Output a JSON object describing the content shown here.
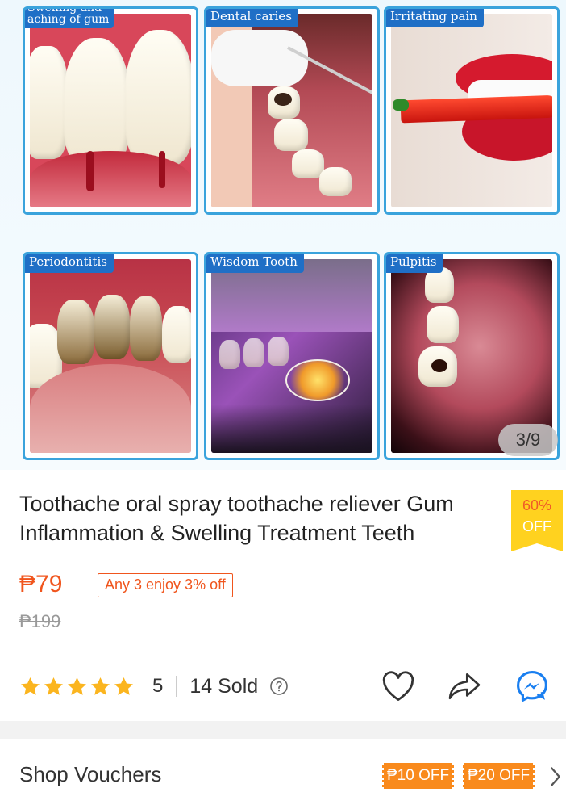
{
  "gallery": {
    "tiles": [
      {
        "label": "Swelling and\naching of gum"
      },
      {
        "label": "Dental caries"
      },
      {
        "label": "Irritating pain"
      },
      {
        "label": "Periodontitis"
      },
      {
        "label": "Wisdom Tooth"
      },
      {
        "label": "Pulpitis"
      }
    ],
    "counter": "3/9",
    "frame_color": "#3aa3dc",
    "tag_color": "#1f6fc6"
  },
  "product": {
    "title": "Toothache oral spray toothache reliever Gum Inflammation & Swelling Treatment Teeth",
    "discount_pct": "60%",
    "discount_off": "OFF",
    "price": "₱79",
    "promo": "Any 3 enjoy 3% off",
    "original_price": "₱199",
    "rating": "5",
    "stars_filled": 5,
    "sold": "14 Sold",
    "accent_color": "#f0551d"
  },
  "actions": {
    "favorite_icon": "heart-icon",
    "share_icon": "share-icon",
    "chat_icon": "messenger-icon"
  },
  "vouchers": {
    "label": "Shop Vouchers",
    "items": [
      "₱10 OFF",
      "₱20 OFF"
    ]
  }
}
